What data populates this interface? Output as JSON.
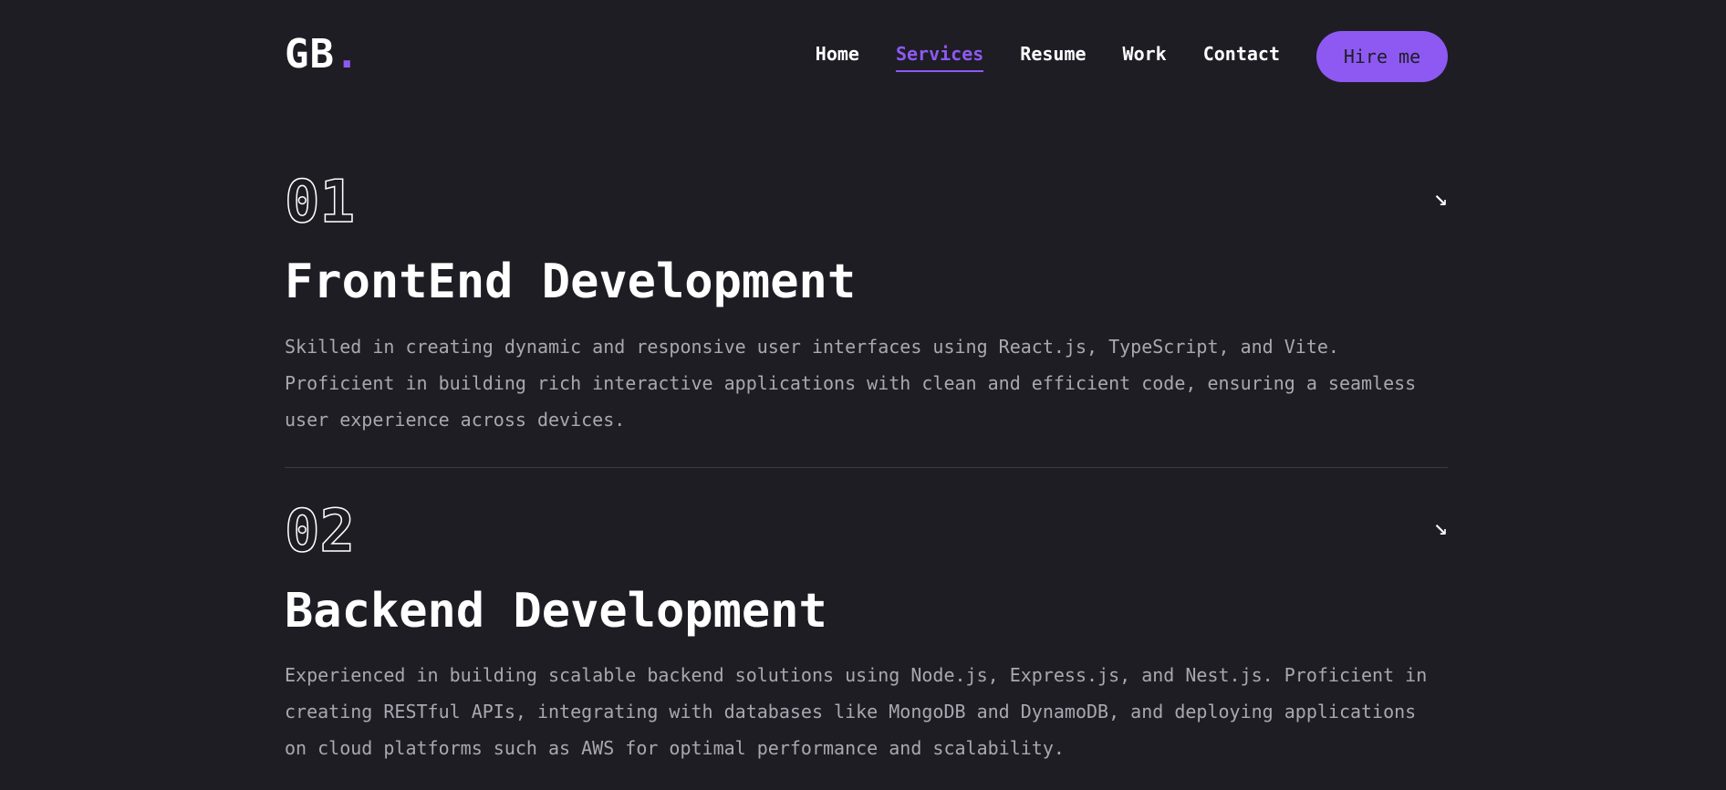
{
  "logo": {
    "text": "GB",
    "dot": "."
  },
  "nav": {
    "items": [
      {
        "label": "Home",
        "active": false
      },
      {
        "label": "Services",
        "active": true
      },
      {
        "label": "Resume",
        "active": false
      },
      {
        "label": "Work",
        "active": false
      },
      {
        "label": "Contact",
        "active": false
      }
    ],
    "hire_label": "Hire me"
  },
  "services": [
    {
      "num": "01",
      "title": "FrontEnd Development",
      "desc": "Skilled in creating dynamic and responsive user interfaces using React.js, TypeScript, and Vite. Proficient in building rich interactive applications with clean and efficient code, ensuring a seamless user experience across devices.",
      "arrow_icon": "arrow-down-right-icon"
    },
    {
      "num": "02",
      "title": "Backend Development",
      "desc": "Experienced in building scalable backend solutions using Node.js, Express.js, and Nest.js. Proficient in creating RESTful APIs, integrating with databases like MongoDB and DynamoDB, and deploying applications on cloud platforms such as AWS for optimal performance and scalability.",
      "arrow_icon": "arrow-down-right-icon"
    }
  ],
  "colors": {
    "background": "#1e1d24",
    "accent": "#8e59f2",
    "text_muted": "#a9a8b0"
  }
}
